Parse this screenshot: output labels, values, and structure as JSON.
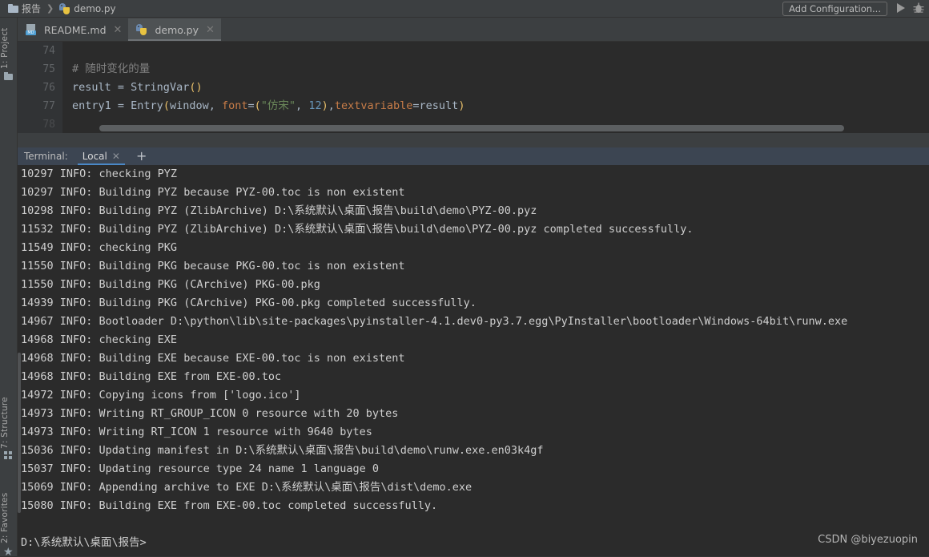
{
  "window": {
    "breadcrumb": [
      {
        "icon": "folder-icon",
        "label": "报告"
      },
      {
        "icon": "python-file-icon",
        "label": "demo.py"
      }
    ],
    "breadcrumb_separator": "❯",
    "add_configuration_label": "Add Configuration...",
    "run_icon": "run-icon",
    "debug_icon": "debug-icon"
  },
  "tool_strip": {
    "project_label": "1: Project",
    "structure_label": "7: Structure",
    "favorites_label": "2: Favorites",
    "favorites_glyph": "★"
  },
  "editor_tabs": [
    {
      "label": "README.md",
      "icon": "markdown-file-icon",
      "active": false,
      "close": "✕"
    },
    {
      "label": "demo.py",
      "icon": "python-file-icon",
      "active": true,
      "close": "✕"
    }
  ],
  "editor": {
    "line_numbers": [
      "74",
      "75",
      "76",
      "77",
      "78"
    ],
    "lines": [
      {
        "n": 74,
        "segments": []
      },
      {
        "n": 75,
        "segments": [
          {
            "t": "# 随时变化的量",
            "c": "c-comment"
          }
        ]
      },
      {
        "n": 76,
        "segments": [
          {
            "t": "result ",
            "c": "c-id"
          },
          {
            "t": "= ",
            "c": "c-op"
          },
          {
            "t": "StringVar",
            "c": "c-id"
          },
          {
            "t": "()",
            "c": "c-paren"
          }
        ]
      },
      {
        "n": 77,
        "segments": [
          {
            "t": "entry1 ",
            "c": "c-id"
          },
          {
            "t": "= ",
            "c": "c-op"
          },
          {
            "t": "Entry",
            "c": "c-id"
          },
          {
            "t": "(",
            "c": "c-paren"
          },
          {
            "t": "window, ",
            "c": "c-id"
          },
          {
            "t": "font",
            "c": "c-kwarg"
          },
          {
            "t": "=",
            "c": "c-op"
          },
          {
            "t": "(",
            "c": "c-paren"
          },
          {
            "t": "\"仿宋\"",
            "c": "c-str"
          },
          {
            "t": ", ",
            "c": "c-op"
          },
          {
            "t": "12",
            "c": "c-num"
          },
          {
            "t": ")",
            "c": "c-paren"
          },
          {
            "t": ",",
            "c": "c-op"
          },
          {
            "t": "textvariable",
            "c": "c-kwarg"
          },
          {
            "t": "=",
            "c": "c-op"
          },
          {
            "t": "result",
            "c": "c-id"
          },
          {
            "t": ")",
            "c": "c-paren"
          }
        ]
      }
    ]
  },
  "terminal": {
    "title": "Terminal:",
    "tab_label": "Local",
    "tab_close": "✕",
    "add_label": "+",
    "prompt": "D:\\系统默认\\桌面\\报告>",
    "lines": [
      "10297 INFO: checking PYZ",
      "10297 INFO: Building PYZ because PYZ-00.toc is non existent",
      "10298 INFO: Building PYZ (ZlibArchive) D:\\系统默认\\桌面\\报告\\build\\demo\\PYZ-00.pyz",
      "11532 INFO: Building PYZ (ZlibArchive) D:\\系统默认\\桌面\\报告\\build\\demo\\PYZ-00.pyz completed successfully.",
      "11549 INFO: checking PKG",
      "11550 INFO: Building PKG because PKG-00.toc is non existent",
      "11550 INFO: Building PKG (CArchive) PKG-00.pkg",
      "14939 INFO: Building PKG (CArchive) PKG-00.pkg completed successfully.",
      "14967 INFO: Bootloader D:\\python\\lib\\site-packages\\pyinstaller-4.1.dev0-py3.7.egg\\PyInstaller\\bootloader\\Windows-64bit\\runw.exe",
      "14968 INFO: checking EXE",
      "14968 INFO: Building EXE because EXE-00.toc is non existent",
      "14968 INFO: Building EXE from EXE-00.toc",
      "14972 INFO: Copying icons from ['logo.ico']",
      "14973 INFO: Writing RT_GROUP_ICON 0 resource with 20 bytes",
      "14973 INFO: Writing RT_ICON 1 resource with 9640 bytes",
      "15036 INFO: Updating manifest in D:\\系统默认\\桌面\\报告\\build\\demo\\runw.exe.en03k4gf",
      "15037 INFO: Updating resource type 24 name 1 language 0",
      "15069 INFO: Appending archive to EXE D:\\系统默认\\桌面\\报告\\dist\\demo.exe",
      "15080 INFO: Building EXE from EXE-00.toc completed successfully."
    ]
  },
  "watermark": "CSDN @biyezuopin",
  "colors": {
    "window_bg": "#3c3f41",
    "editor_bg": "#2b2b2b",
    "gutter_bg": "#313335",
    "terminal_header_bg": "#3c4552",
    "accent_blue": "#4a88c7",
    "text": "#bbbbbb",
    "code_text": "#a9b7c6",
    "comment": "#808080",
    "string": "#6a8759",
    "number": "#6897bb",
    "kwarg": "#c77c48",
    "paren": "#e8bf6a"
  }
}
